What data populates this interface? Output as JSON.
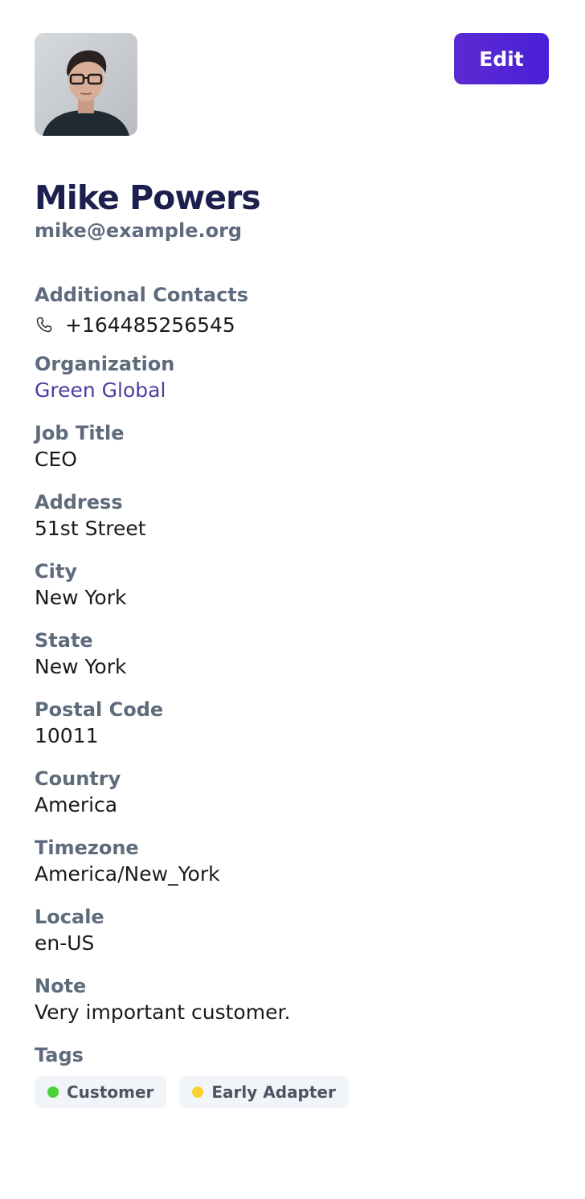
{
  "header": {
    "edit_label": "Edit",
    "avatar_alt": "Mike Powers"
  },
  "profile": {
    "name": "Mike Powers",
    "email": "mike@example.org"
  },
  "fields": {
    "additional_contacts": {
      "label": "Additional Contacts",
      "phone": "+164485256545",
      "icon": "phone-icon"
    },
    "organization": {
      "label": "Organization",
      "value": "Green Global"
    },
    "job_title": {
      "label": "Job Title",
      "value": "CEO"
    },
    "address": {
      "label": "Address",
      "value": "51st Street"
    },
    "city": {
      "label": "City",
      "value": "New York"
    },
    "state": {
      "label": "State",
      "value": "New York"
    },
    "postal_code": {
      "label": "Postal Code",
      "value": "10011"
    },
    "country": {
      "label": "Country",
      "value": "America"
    },
    "timezone": {
      "label": "Timezone",
      "value": "America/New_York"
    },
    "locale": {
      "label": "Locale",
      "value": "en-US"
    },
    "note": {
      "label": "Note",
      "value": "Very important customer."
    }
  },
  "tags": {
    "label": "Tags",
    "items": [
      {
        "label": "Customer",
        "color": "#4cd137"
      },
      {
        "label": "Early Adapter",
        "color": "#fbd12f"
      }
    ]
  },
  "colors": {
    "accent": "#4a1fd8",
    "name_text": "#1d1f4f",
    "label_text": "#5e6b7d",
    "link_text": "#4a3fa2",
    "tag_background": "#f1f5fa"
  }
}
